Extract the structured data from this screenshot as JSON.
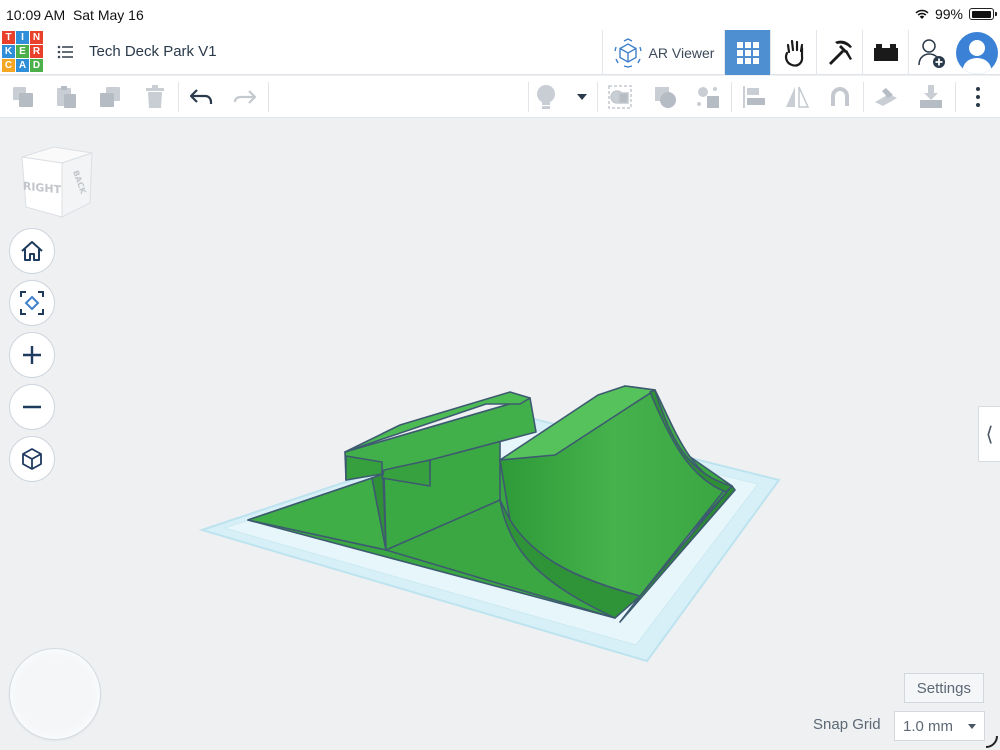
{
  "status_bar": {
    "time": "10:09 AM",
    "date": "Sat May 16",
    "battery": "99%",
    "battery_level": 0.99,
    "wifi_icon": "wifi-icon"
  },
  "app": {
    "logo_letters": [
      "T",
      "I",
      "N",
      "K",
      "E",
      "R",
      "C",
      "A",
      "D"
    ],
    "logo_colors": [
      "#e8402a",
      "#2f8fd8",
      "#e8402a",
      "#2f8fd8",
      "#4bb04a",
      "#e8402a",
      "#f5a623",
      "#2f8fd8",
      "#4bb04a"
    ],
    "design_title": "Tech Deck Park V1",
    "ar_viewer_label": "AR Viewer",
    "header_buttons": [
      "grid-view-icon",
      "hand-icon",
      "pickaxe-icon",
      "brick-icon",
      "add-user-icon",
      "avatar"
    ]
  },
  "toolbar": {
    "buttons": [
      "copy-icon",
      "paste-icon",
      "duplicate-icon",
      "delete-icon",
      "undo-icon",
      "redo-icon",
      "light-bulb-icon",
      "dropdown-caret-icon",
      "group-icon",
      "ungroup-icon",
      "fragment-icon",
      "align-icon",
      "mirror-icon",
      "cruise-icon",
      "workplane-icon",
      "import-icon",
      "more-icon"
    ]
  },
  "viewport": {
    "view_cube": {
      "front_label": "RIGHT",
      "side_label": "BACK"
    },
    "nav_buttons": [
      "home-icon",
      "fit-icon",
      "zoom-in-icon",
      "zoom-out-icon",
      "ortho-icon"
    ],
    "model_color": "#3da544",
    "workplane_color": "#c8ecf6"
  },
  "footer": {
    "settings_label": "Settings",
    "snap_grid_label": "Snap Grid",
    "snap_grid_value": "1.0 mm"
  }
}
